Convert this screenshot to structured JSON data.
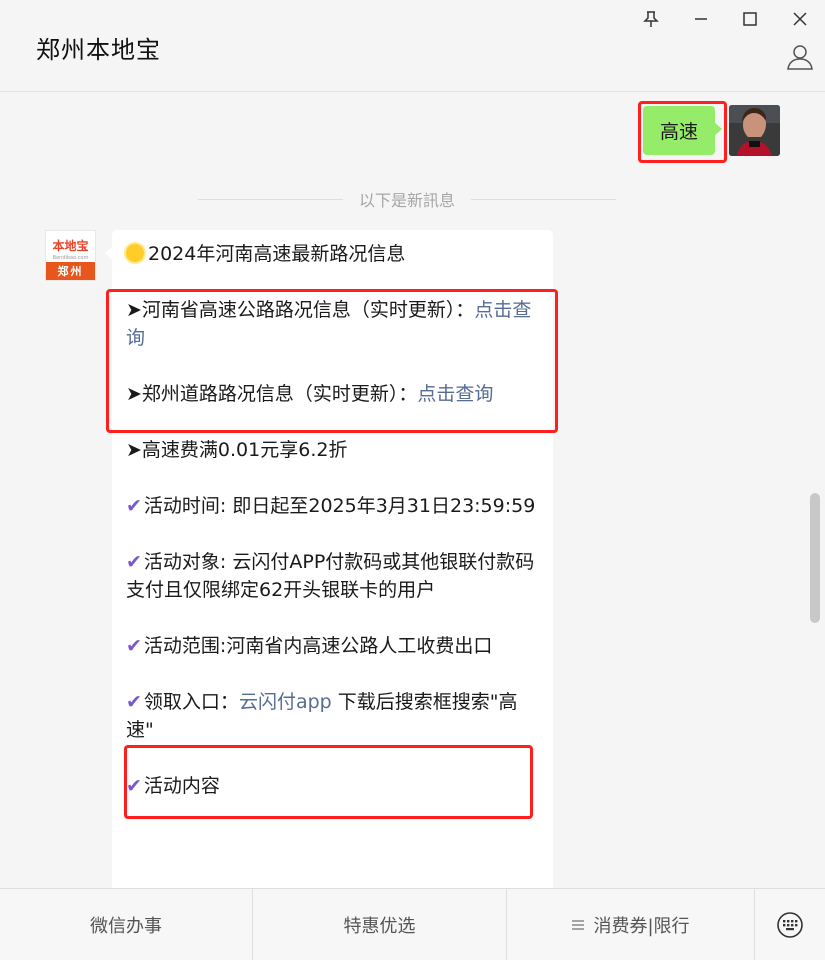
{
  "window": {
    "title": "郑州本地宝",
    "controls": [
      "pin-icon",
      "minimize-icon",
      "maximize-icon",
      "close-icon"
    ],
    "profile_icon": "person-icon"
  },
  "chat": {
    "sent_message": "高速",
    "separator": "以下是新訊息",
    "bot_avatar": {
      "logo_text": "本地宝",
      "logo_sub": "Bendibao.com",
      "city": "郑州"
    },
    "reply": {
      "title": "2024年河南高速最新路况信息",
      "road1_text": "➤河南省高速公路路况信息（实时更新）：",
      "road1_link": "点击查询",
      "road2_text": "➤郑州道路路况信息（实时更新）：",
      "road2_link": "点击查询",
      "promo": "➤高速费满0.01元享6.2折",
      "time": "活动时间: 即日起至2025年3月31日23:59:59",
      "target": "活动对象: 云闪付APP付款码或其他银联付款码支付且仅限绑定62开头银联卡的用户",
      "scope": "活动范围:河南省内高速公路人工收费出口",
      "entry_prefix": "领取入口：",
      "entry_link": "云闪付app",
      "entry_suffix": " 下载后搜索框搜索\"高速\"",
      "content": "活动内容"
    }
  },
  "accent": {
    "bubble_green": "#95ec69",
    "link_blue": "#576b95",
    "highlight_red": "#ff1f1f",
    "check_purple": "#7a57d1"
  },
  "menu": {
    "item1": "微信办事",
    "item2": "特惠优选",
    "item3": "消费券|限行",
    "item3_icon": "menu-lines-icon",
    "keyboard_icon": "keyboard-icon"
  }
}
